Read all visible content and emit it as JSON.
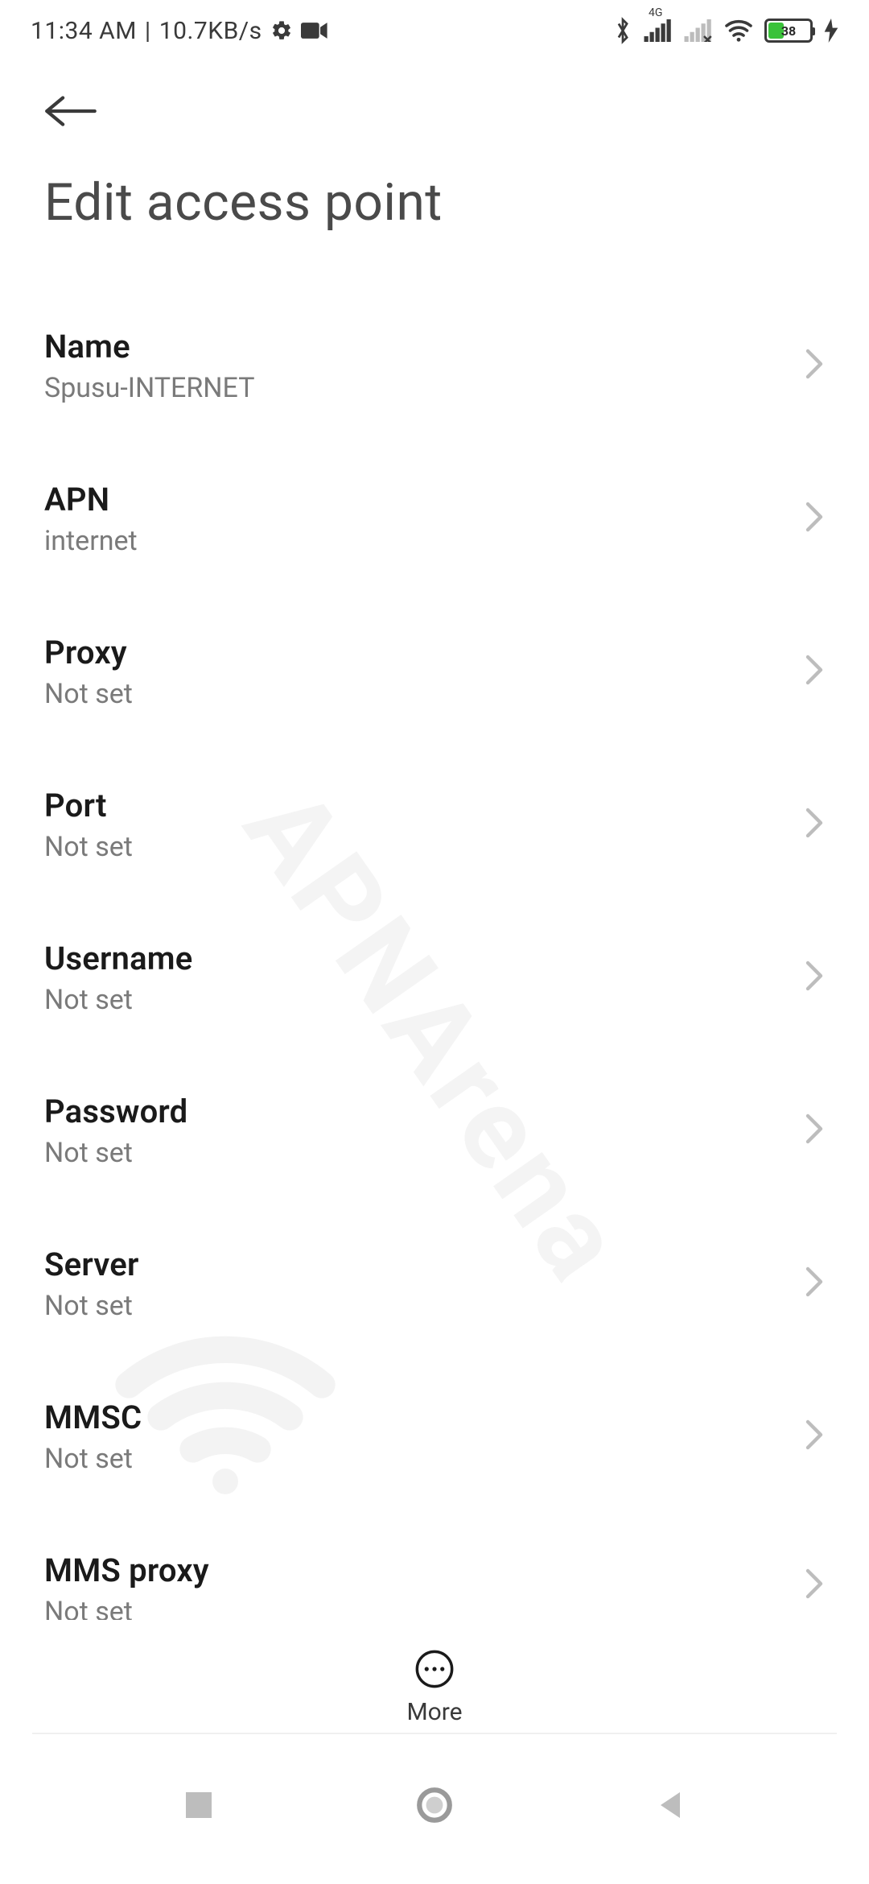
{
  "status_bar": {
    "time": "11:34 AM",
    "separator": "|",
    "network_speed": "10.7KB/s",
    "battery_percent": "38",
    "network_label": "4G"
  },
  "header": {
    "title": "Edit access point"
  },
  "settings": [
    {
      "label": "Name",
      "value": "Spusu-INTERNET"
    },
    {
      "label": "APN",
      "value": "internet"
    },
    {
      "label": "Proxy",
      "value": "Not set"
    },
    {
      "label": "Port",
      "value": "Not set"
    },
    {
      "label": "Username",
      "value": "Not set"
    },
    {
      "label": "Password",
      "value": "Not set"
    },
    {
      "label": "Server",
      "value": "Not set"
    },
    {
      "label": "MMSC",
      "value": "Not set"
    },
    {
      "label": "MMS proxy",
      "value": "Not set"
    }
  ],
  "more_button": {
    "label": "More"
  },
  "watermark": "APNArena"
}
